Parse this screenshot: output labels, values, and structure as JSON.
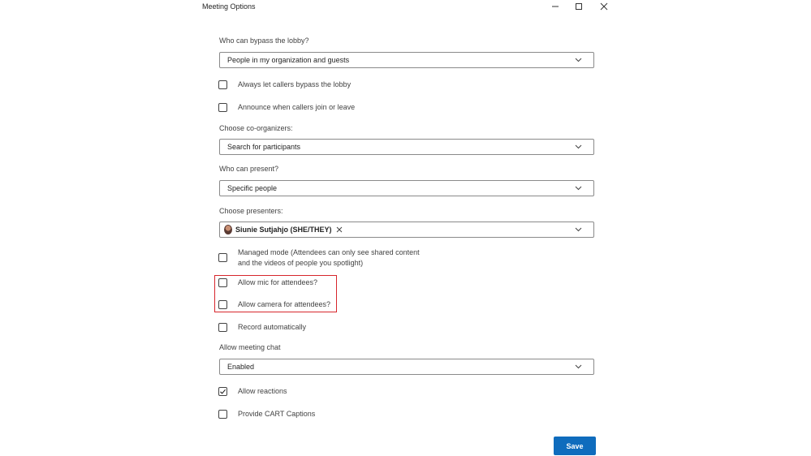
{
  "window": {
    "title": "Meeting Options"
  },
  "lobby": {
    "label": "Who can bypass the lobby?",
    "value": "People in my organization and guests"
  },
  "callers_bypass": {
    "label": "Always let callers bypass the lobby",
    "checked": false
  },
  "announce_callers": {
    "label": "Announce when callers join or leave",
    "checked": false
  },
  "coorganizers": {
    "label": "Choose co-organizers:",
    "placeholder": "Search for participants"
  },
  "presenters_who": {
    "label": "Who can present?",
    "value": "Specific people"
  },
  "presenters_choose": {
    "label": "Choose presenters:",
    "chip_name": "Siunie Sutjahjo (SHE/THEY)"
  },
  "managed_mode": {
    "label_line1": "Managed mode (Attendees can only see shared content",
    "label_line2": "and the videos of people you spotlight)",
    "checked": false
  },
  "allow_mic": {
    "label": "Allow mic for attendees?",
    "checked": false
  },
  "allow_camera": {
    "label": "Allow camera for attendees?",
    "checked": false
  },
  "record_auto": {
    "label": "Record automatically",
    "checked": false
  },
  "meeting_chat": {
    "label": "Allow meeting chat",
    "value": "Enabled"
  },
  "allow_reactions": {
    "label": "Allow reactions",
    "checked": true
  },
  "cart_captions": {
    "label": "Provide CART Captions",
    "checked": false
  },
  "footer": {
    "save_label": "Save"
  },
  "colors": {
    "accent": "#0f6cbd",
    "highlight": "#d7262c"
  },
  "icons": {
    "minimize": "minimize-icon",
    "maximize": "maximize-icon",
    "close": "close-icon",
    "chevron": "chevron-down-icon",
    "remove": "remove-icon",
    "check": "checkmark-icon"
  }
}
